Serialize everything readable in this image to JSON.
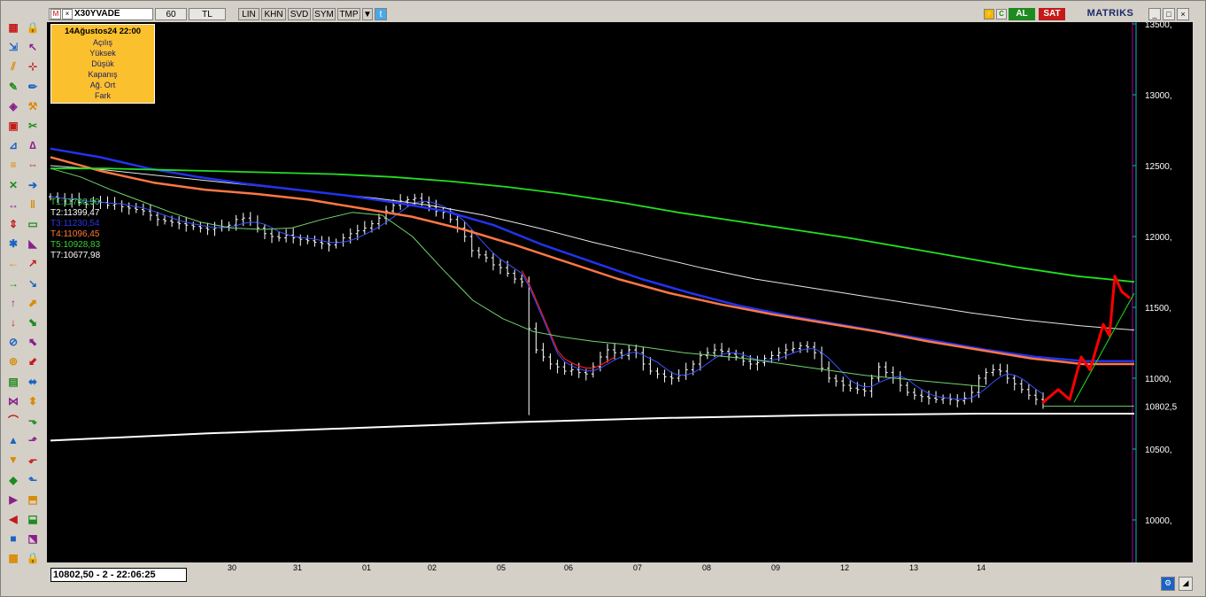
{
  "toolbar": {
    "symbol": "X30YVADE",
    "period": "60",
    "currency": "TL",
    "buttons": [
      "LIN",
      "KHN",
      "SVD",
      "SYM",
      "TMP"
    ],
    "buy_label": "AL",
    "sell_label": "SAT",
    "brand": "MATRIKS"
  },
  "infobox": {
    "date": "14Ağustos24 22:00",
    "rows": [
      "Açılış",
      "Yüksek",
      "Düşük",
      "Kapanış",
      "Ağ. Ort",
      "Fark"
    ]
  },
  "trend_labels": [
    {
      "text": "T1:11760,50",
      "color": "#39d039"
    },
    {
      "text": "T2:11399,47",
      "color": "#ffffff"
    },
    {
      "text": "T3:11230,54",
      "color": "#2a34e8"
    },
    {
      "text": "T4:11096,45",
      "color": "#ff7a3a"
    },
    {
      "text": "T5:10928,83",
      "color": "#39d039"
    },
    {
      "text": "T7:10677,98",
      "color": "#ffffff"
    }
  ],
  "status_text": "10802,50 - 2 - 22:06:25",
  "colors": {
    "background": "#000000",
    "axis": "#00bcbc",
    "ma_green": "#22e022",
    "ma_white": "#e8e8e8",
    "ma_blue": "#2233ee",
    "ma_orange": "#ff7744",
    "ma_thin_green": "#6fd46f",
    "ma_thin_blue": "#3a50ff",
    "ma_red": "#ee1b1b",
    "bars": "#ffffff",
    "hand_drawn": "#ff0000"
  },
  "chart_data": {
    "type": "line",
    "title": "",
    "ylim": [
      9700,
      13500
    ],
    "y_ticks": [
      {
        "label": "13500,",
        "value": 13500
      },
      {
        "label": "13000,",
        "value": 13000
      },
      {
        "label": "12500,",
        "value": 12500
      },
      {
        "label": "12000,",
        "value": 12000
      },
      {
        "label": "11500,",
        "value": 11500
      },
      {
        "label": "11000,",
        "value": 11000
      },
      {
        "label": "10500,",
        "value": 10500
      },
      {
        "label": "10000,",
        "value": 10000
      }
    ],
    "last_price_label": "10802,5",
    "last_price": 10802.5,
    "x_labels": [
      "30",
      "31",
      "01",
      "02",
      "05",
      "06",
      "07",
      "08",
      "09",
      "12",
      "13",
      "14"
    ],
    "n_bars": 140,
    "grid": false,
    "ohlc_close": [
      12280,
      12270,
      12250,
      12260,
      12240,
      12230,
      12250,
      12240,
      12220,
      12230,
      12210,
      12200,
      12190,
      12180,
      12150,
      12120,
      12110,
      12100,
      12090,
      12080,
      12070,
      12060,
      12050,
      12060,
      12070,
      12080,
      12120,
      12130,
      12100,
      12060,
      12020,
      12000,
      11990,
      12010,
      11990,
      11980,
      11970,
      11960,
      11950,
      11940,
      11960,
      11990,
      12020,
      12040,
      12060,
      12090,
      12130,
      12180,
      12220,
      12250,
      12260,
      12270,
      12240,
      12210,
      12180,
      12170,
      12120,
      12060,
      12000,
      11900,
      11870,
      11850,
      11800,
      11780,
      11740,
      11700,
      11680,
      11350,
      11200,
      11150,
      11100,
      11080,
      11050,
      11060,
      11040,
      11030,
      11080,
      11150,
      11200,
      11180,
      11160,
      11200,
      11180,
      11100,
      11050,
      11030,
      11010,
      11000,
      11020,
      11060,
      11100,
      11160,
      11180,
      11200,
      11190,
      11170,
      11150,
      11120,
      11100,
      11110,
      11140,
      11160,
      11180,
      11200,
      11210,
      11230,
      11220,
      11180,
      11070,
      11000,
      10980,
      10950,
      10930,
      10920,
      10910,
      11000,
      11080,
      11040,
      11000,
      10950,
      10900,
      10880,
      10870,
      10860,
      10850,
      10860,
      10850,
      10840,
      10860,
      10900,
      11000,
      11040,
      11060,
      11050,
      11000,
      10960,
      10920,
      10880,
      10850,
      10830
    ],
    "series": [
      {
        "name": "T1",
        "values": [
          12480,
          12420,
          12330,
          12250,
          12170,
          12100,
          12060,
          12050,
          12060,
          12120,
          12170,
          12150,
          12000,
          11770,
          11550,
          11420,
          11330,
          11290,
          11260,
          11240,
          11210,
          11180,
          11160,
          11140,
          11110,
          11080,
          11050,
          11020,
          11000,
          10980,
          10960,
          10940
        ]
      },
      {
        "name": "T2",
        "values": [
          12500,
          12470,
          12430,
          12390,
          12350,
          12310,
          12270,
          12220,
          12150,
          12060,
          11960,
          11870,
          11780,
          11700,
          11640,
          11580,
          11520,
          11460,
          11410,
          11370,
          11340
        ]
      },
      {
        "name": "T3",
        "values": [
          12620,
          12560,
          12480,
          12420,
          12370,
          12330,
          12290,
          12240,
          12180,
          12080,
          11940,
          11820,
          11700,
          11600,
          11510,
          11440,
          11380,
          11320,
          11260,
          11200,
          11150,
          11120,
          11120
        ]
      },
      {
        "name": "T4",
        "values": [
          12560,
          12460,
          12380,
          12330,
          12300,
          12260,
          12200,
          12140,
          12050,
          11940,
          11820,
          11700,
          11600,
          11520,
          11450,
          11390,
          11330,
          11260,
          11200,
          11140,
          11100,
          11100
        ]
      },
      {
        "name": "T5",
        "values": [
          12480,
          12480,
          12470,
          12460,
          12450,
          12440,
          12420,
          12390,
          12350,
          12300,
          12240,
          12170,
          12110,
          12050,
          11990,
          11920,
          11850,
          11780,
          11720,
          11680
        ]
      },
      {
        "name": "T7",
        "values": [
          10560,
          10610,
          10650,
          10690,
          10720,
          10740,
          10750,
          10750
        ]
      }
    ]
  }
}
